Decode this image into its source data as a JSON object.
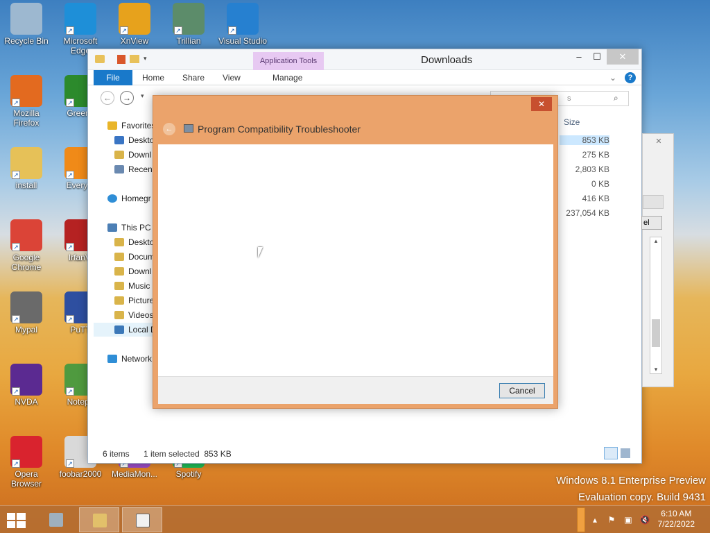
{
  "desktop": {
    "icons": [
      {
        "label": "Recycle Bin",
        "color": "#9db8d0"
      },
      {
        "label": "Microsoft Edge",
        "color": "#1e8fd8"
      },
      {
        "label": "XnView",
        "color": "#e7a21c"
      },
      {
        "label": "Trillian",
        "color": "#5c8c6a"
      },
      {
        "label": "Visual Studio",
        "color": "#2680d0"
      },
      {
        "label": "Mozilla Firefox",
        "color": "#e36a1f"
      },
      {
        "label": "Greens",
        "color": "#2c8a2c"
      },
      {
        "label": "install",
        "color": "#e6c158"
      },
      {
        "label": "Everyth",
        "color": "#f08a18"
      },
      {
        "label": "Google Chrome",
        "color": "#db4437"
      },
      {
        "label": "IrfanVi",
        "color": "#b52222"
      },
      {
        "label": "Mypal",
        "color": "#6a6a6a"
      },
      {
        "label": "PuTT",
        "color": "#2e4fa0"
      },
      {
        "label": "NVDA",
        "color": "#5b2a91"
      },
      {
        "label": "Notepa",
        "color": "#4f9a3f"
      },
      {
        "label": "Opera Browser",
        "color": "#d9232e"
      },
      {
        "label": "foobar2000",
        "color": "#d9d9d9"
      },
      {
        "label": "MediaMon...",
        "color": "#9a4bc4"
      },
      {
        "label": "Spotify",
        "color": "#1db954"
      }
    ],
    "watermark_line1": "Windows 8.1 Enterprise Preview",
    "watermark_line2": "Evaluation copy. Build 9431"
  },
  "explorer": {
    "title": "Downloads",
    "context_tab": "Application Tools",
    "tabs": {
      "file": "File",
      "home": "Home",
      "share": "Share",
      "view": "View",
      "manage": "Manage"
    },
    "search_placeholder": "s",
    "column_size": "Size",
    "sizes": [
      "853 KB",
      "275 KB",
      "2,803 KB",
      "0 KB",
      "416 KB",
      "237,054 KB"
    ],
    "nav": {
      "favorites": "Favorites",
      "desktop": "Deskto",
      "downloads": "Downl",
      "recent": "Recent",
      "homegroup": "Homegr",
      "this_pc": "This PC",
      "pc_desktop": "Deskto",
      "documents": "Docum",
      "pc_downloads": "Downl",
      "music": "Music",
      "pictures": "Picture",
      "videos": "Videos",
      "local_disk": "Local D",
      "network": "Network"
    },
    "status_items": "6 items",
    "status_selected": "1 item selected  853 KB"
  },
  "background_dialog": {
    "button_fragment": "el"
  },
  "troubleshooter": {
    "title": "Program Compatibility Troubleshooter",
    "cancel_label": "Cancel",
    "close_glyph": "✕"
  },
  "taskbar": {
    "time": "6:10 AM",
    "date": "7/22/2022"
  }
}
